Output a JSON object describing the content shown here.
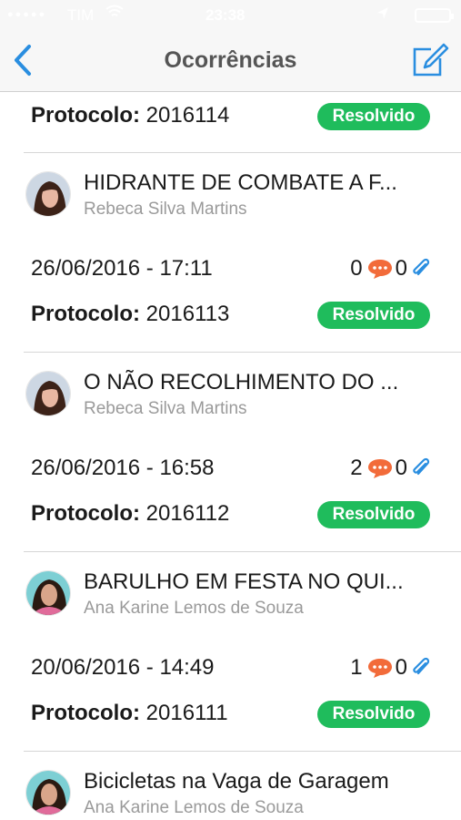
{
  "status_bar": {
    "carrier": "TIM",
    "time": "23:38"
  },
  "header": {
    "title": "Ocorrências"
  },
  "protocol_label": "Protocolo:",
  "first": {
    "protocol": "2016114",
    "status": "Resolvido"
  },
  "items": [
    {
      "title": "HIDRANTE DE COMBATE A F...",
      "author": "Rebeca Silva Martins",
      "datetime": "26/06/2016 - 17:11",
      "comments": "0",
      "attachments": "0",
      "protocol": "2016113",
      "status": "Resolvido"
    },
    {
      "title": "O NÃO RECOLHIMENTO DO ...",
      "author": "Rebeca Silva Martins",
      "datetime": "26/06/2016 - 16:58",
      "comments": "2",
      "attachments": "0",
      "protocol": "2016112",
      "status": "Resolvido"
    },
    {
      "title": "BARULHO EM FESTA NO QUI...",
      "author": "Ana Karine Lemos de Souza",
      "datetime": "20/06/2016 - 14:49",
      "comments": "1",
      "attachments": "0",
      "protocol": "2016111",
      "status": "Resolvido"
    }
  ],
  "last": {
    "title": "Bicicletas na Vaga de Garagem",
    "author": "Ana Karine Lemos de Souza"
  },
  "colors": {
    "accent": "#2a8ee0",
    "badge": "#1fbc5c",
    "comment": "#f26b3a"
  }
}
